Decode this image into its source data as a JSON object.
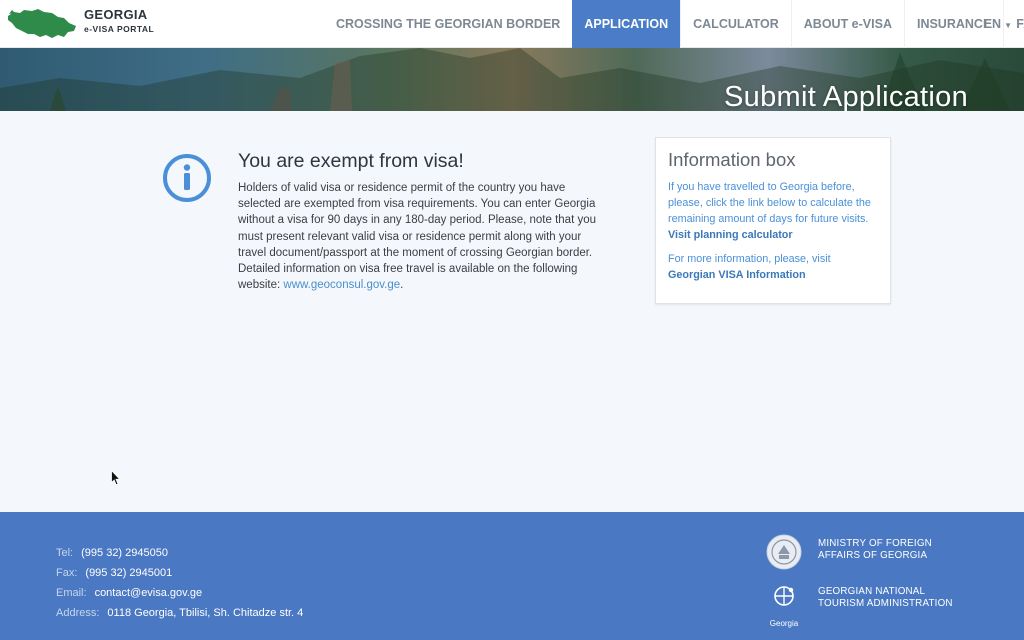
{
  "header": {
    "brand_title": "GEORGIA",
    "brand_subtitle": "e-VISA PORTAL",
    "nav": [
      {
        "label": "CROSSING THE GEORGIAN BORDER",
        "active": false
      },
      {
        "label": "APPLICATION",
        "active": true
      },
      {
        "label": "CALCULATOR",
        "active": false
      },
      {
        "label": "ABOUT e-VISA",
        "active": false
      },
      {
        "label": "INSURANCE",
        "active": false
      },
      {
        "label": "FAQ",
        "active": false
      }
    ],
    "language": "EN"
  },
  "banner": {
    "title": "Submit Application"
  },
  "main": {
    "exempt_title": "You are exempt from visa!",
    "exempt_text": "Holders of valid visa or residence permit of the country you have selected are exempted from visa requirements. You can enter Georgia without a visa for 90 days in any 180-day period. Please, note that you must present relevant valid visa or residence permit along with your travel document/passport at the moment of crossing Georgian border. Detailed information on visa free travel is available on the following website:",
    "exempt_link": "www.geoconsul.gov.ge",
    "exempt_link_suffix": "."
  },
  "info_box": {
    "title": "Information box",
    "p1_text": "If you have travelled to Georgia before, please, click the link below to calculate the remaining amount of days for future visits.",
    "p1_link": "Visit planning calculator",
    "p2_text": "For more information, please, visit",
    "p2_link": "Georgian VISA Information"
  },
  "footer": {
    "contact": [
      {
        "key": "Tel:",
        "value": "(995 32) 2945050"
      },
      {
        "key": "Fax:",
        "value": "(995 32) 2945001"
      },
      {
        "key": "Email:",
        "value": "contact@evisa.gov.ge"
      },
      {
        "key": "Address:",
        "value": "0118 Georgia, Tbilisi, Sh. Chitadze str. 4"
      }
    ],
    "orgs": [
      {
        "name": "MINISTRY OF FOREIGN AFFAIRS OF GEORGIA"
      },
      {
        "name": "GEORGIAN NATIONAL TOURISM ADMINISTRATION",
        "caption": "Georgia"
      }
    ]
  },
  "colors": {
    "accent": "#4a7cc7",
    "footer_bg": "#4a78c2",
    "link": "#4a90d9",
    "logo_green": "#2e8b4a"
  },
  "icons": {
    "info": "info-circle-icon",
    "cursor": "mouse-pointer-icon"
  }
}
